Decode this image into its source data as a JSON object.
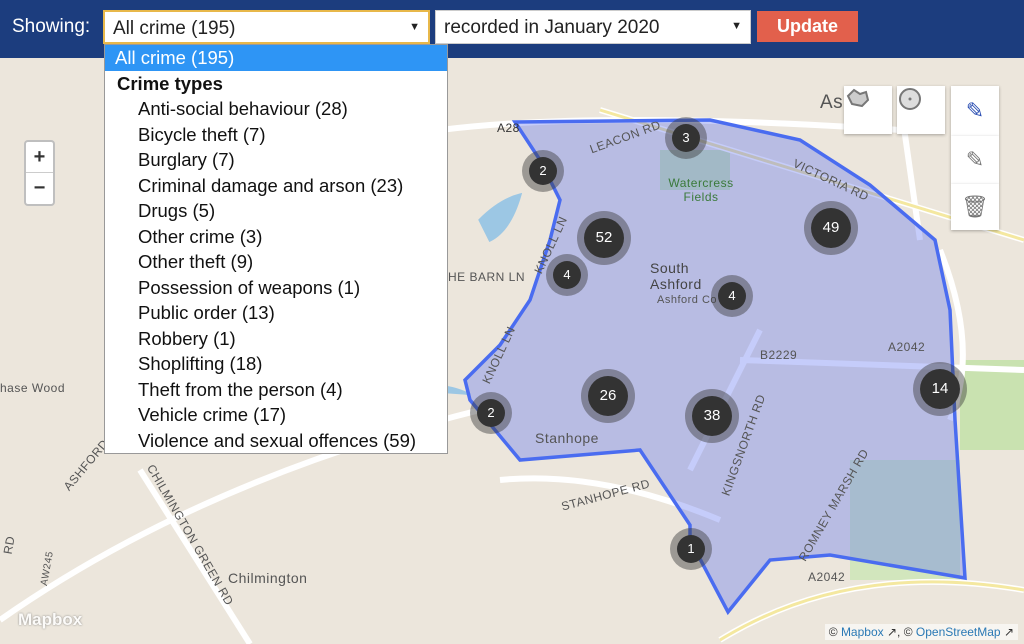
{
  "header": {
    "showing_label": "Showing:",
    "crime_select": "All crime (195)",
    "period_select": "recorded in January 2020",
    "update_label": "Update"
  },
  "dropdown": {
    "selected": "All crime (195)",
    "group_label": "Crime types",
    "items": [
      "Anti-social behaviour (28)",
      "Bicycle theft (7)",
      "Burglary (7)",
      "Criminal damage and arson (23)",
      "Drugs (5)",
      "Other crime (3)",
      "Other theft (9)",
      "Possession of weapons (1)",
      "Public order (13)",
      "Robbery (1)",
      "Shoplifting (18)",
      "Theft from the person (4)",
      "Vehicle crime (17)",
      "Violence and sexual offences (59)"
    ]
  },
  "map": {
    "zoom_in": "+",
    "zoom_out": "−",
    "clusters": [
      "3",
      "2",
      "52",
      "49",
      "4",
      "4",
      "26",
      "38",
      "2",
      "14",
      "1"
    ],
    "labels": [
      "Ashford",
      "A28",
      "LEACON RD",
      "Watercress Fields",
      "VICTORIA RD",
      "KNOLL LN",
      "HE BARN LN",
      "South Ashford",
      "Ashford Co",
      "B2229",
      "A2042",
      "KNOLL LN",
      "KINGSNORTH RD",
      "Stanhope",
      "hase Wood",
      "ASHFORD",
      "CHILMINGTON GREEN RD",
      "STANHOPE RD",
      "ROMNEY MARSH RD",
      "A2042",
      "Chilmington",
      "AW245",
      "RD"
    ],
    "polygon_color": "#4a6cf0",
    "logo": "Mapbox",
    "attribution": {
      "mapbox": "Mapbox",
      "osm": "OpenStreetMap",
      "prefix": "©",
      "sep": ", ©"
    }
  },
  "draw_toolbar": {
    "tools": [
      "polygon-icon",
      "circle-icon",
      "pencil-icon",
      "edit-icon",
      "trash-icon"
    ]
  }
}
